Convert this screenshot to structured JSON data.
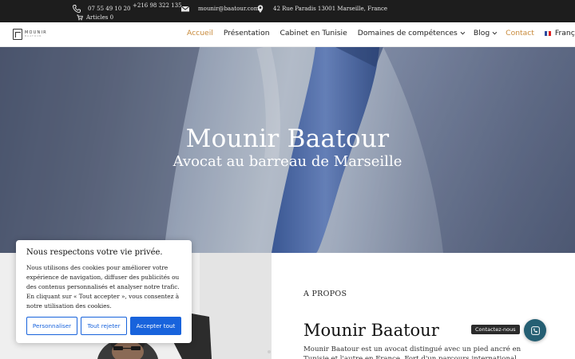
{
  "topbar": {
    "phone1": "07 55 49 10 20",
    "phone2": "+216 98 322 135",
    "email": "mounir@baatour.com",
    "address": "42 Rue Paradis 13001 Marseille, France",
    "cart": "Articles 0",
    "icons": [
      "phone-icon",
      "mail-icon",
      "location-pin-icon",
      "cart-icon"
    ]
  },
  "logo": {
    "name": "MOUNIR",
    "sub": "BAATOUR"
  },
  "menu": [
    {
      "label": "Accueil",
      "state": "active"
    },
    {
      "label": "Présentation"
    },
    {
      "label": "Cabinet en Tunisie"
    },
    {
      "label": "Domaines de compétences",
      "dropdown": true
    },
    {
      "label": "Blog",
      "dropdown": true
    },
    {
      "label": "Contact",
      "state": "accent"
    },
    {
      "label": "Français",
      "dropdown": true,
      "icon": "french-flag-icon"
    }
  ],
  "hero": {
    "title": "Mounir Baatour",
    "subtitle": "Avocat au barreau de Marseille"
  },
  "about": {
    "kicker": "A PROPOS",
    "title": "Mounir Baatour",
    "text": "Mounir Baatour est un avocat distingué avec un pied ancré en Tunisie et l'autre en France. Fort d'un parcours international, Maître Baatour se"
  },
  "cookie": {
    "title": "Nous respectons votre vie privée.",
    "text": "Nous utilisons des cookies pour améliorer votre expérience de navigation, diffuser des publicités ou des contenus personnalisés et analyser notre trafic. En cliquant sur « Tout accepter », vous consentez à notre utilisation des cookies.",
    "customize": "Personnaliser",
    "reject": "Tout rejeter",
    "accept": "Accepter tout"
  },
  "contact": {
    "label": "Contactez-nous"
  },
  "colors": {
    "accent": "#c88a3b",
    "topbar": "#1d1d1d",
    "cookie_blue": "#1863dc",
    "contact_teal": "#255f73"
  }
}
